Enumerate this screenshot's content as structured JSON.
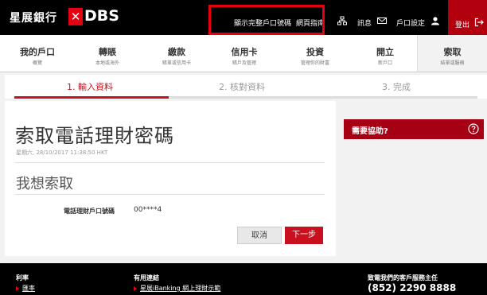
{
  "brand": {
    "chinese_name": "星展銀行",
    "x_mark": "✕",
    "name": "DBS"
  },
  "topbar": {
    "show_full_account": "顯示完整戶口號碼",
    "guide": "網頁指南",
    "messages": "訊息",
    "account_settings": "戶口設定",
    "logout": "登出"
  },
  "nav": [
    {
      "label": "我的戶口",
      "sub": "概覽"
    },
    {
      "label": "轉賬",
      "sub": "本地或海外"
    },
    {
      "label": "繳款",
      "sub": "賬單或信用卡"
    },
    {
      "label": "信用卡",
      "sub": "賬戶及管理"
    },
    {
      "label": "投資",
      "sub": "管理你的財富"
    },
    {
      "label": "開立",
      "sub": "新戶口"
    },
    {
      "label": "索取",
      "sub": "結單或服務"
    }
  ],
  "steps": [
    {
      "label": "1. 輸入資料"
    },
    {
      "label": "2. 核對資料"
    },
    {
      "label": "3. 完成"
    }
  ],
  "main": {
    "title": "索取電話理財密碼",
    "timestamp": "星期六, 28/10/2017 11:38:50 HKT",
    "section_title": "我想索取",
    "field_label": "電話理財戶口號碼",
    "field_value": "00****4",
    "cancel_label": "取消",
    "next_label": "下一步"
  },
  "help": {
    "label": "需要協助?"
  },
  "footer": {
    "rates_heading": "利率",
    "rates_link": "匯率",
    "links_heading": "有用連結",
    "links_item": "星展iBanking 網上理財示範",
    "contact_heading": "致電我們的客戶服務主任",
    "contact_phone": "(852) 2290 8888"
  },
  "colors": {
    "brand_red": "#e60012",
    "button_red": "#c8101e",
    "help_red": "#a50014",
    "topbar_black": "#000000"
  }
}
